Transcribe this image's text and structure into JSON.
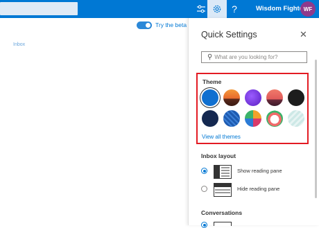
{
  "topbar": {
    "help_label": "?",
    "user_name": "Wisdom Fighters",
    "avatar_initials": "WF",
    "accent": "#0078d4"
  },
  "page": {
    "beta_text": "Try the beta",
    "inbox_faint": "Inbox"
  },
  "quick_settings": {
    "title": "Quick Settings",
    "close_label": "✕",
    "search_placeholder": "What are you looking for?",
    "theme": {
      "label": "Theme",
      "view_all": "View all themes",
      "swatches": [
        {
          "name": "blue",
          "color": "#0f6fd0"
        },
        {
          "name": "sunset",
          "color": "#e7692d"
        },
        {
          "name": "purple",
          "color": "#6b2bd6"
        },
        {
          "name": "desert",
          "color": "#e05a5a"
        },
        {
          "name": "black",
          "color": "#1d1d1d"
        },
        {
          "name": "navy",
          "color": "#142850"
        },
        {
          "name": "circuit",
          "color": "#1e5bb0"
        },
        {
          "name": "colorful",
          "color": "#f2a12b"
        },
        {
          "name": "cartoon",
          "color": "#f06a6a"
        },
        {
          "name": "mint",
          "color": "#cde8e6"
        }
      ]
    },
    "inbox_layout": {
      "title": "Inbox layout",
      "options": [
        {
          "label": "Show reading pane",
          "checked": true
        },
        {
          "label": "Hide reading pane",
          "checked": false
        }
      ]
    },
    "conversations_title": "Conversations"
  }
}
